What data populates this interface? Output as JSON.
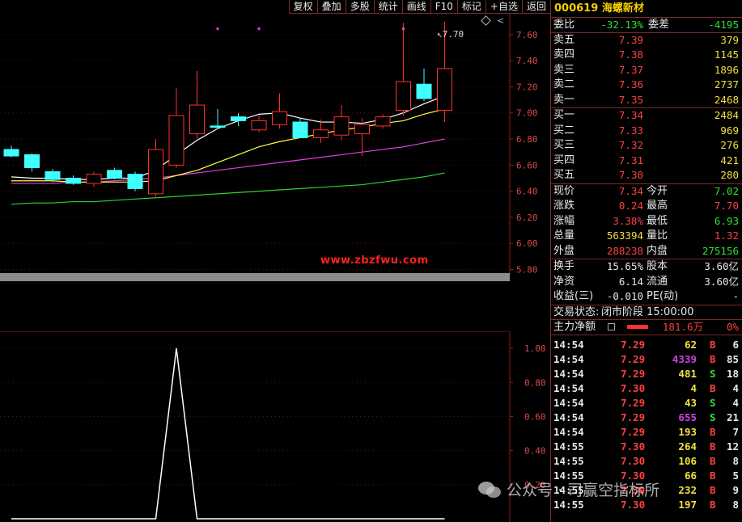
{
  "toolbar": [
    "复权",
    "叠加",
    "多股",
    "统计",
    "画线",
    "F10",
    "标记",
    "+自选",
    "返回"
  ],
  "chart": {
    "price_axis": [
      "7.60",
      "7.40",
      "7.20",
      "7.00",
      "6.80",
      "6.60",
      "6.40",
      "6.20",
      "6.00",
      "5.80"
    ],
    "sub_axis": [
      "1.00",
      "0.80",
      "0.60",
      "0.40",
      "0.20"
    ],
    "high_marker": "7.70",
    "watermark_url": "www.zbzfwu.com",
    "colors": {
      "up": "#ff3030",
      "down": "#40ffff",
      "ma5": "#ffffff",
      "ma10": "#ffff40",
      "ma20": "#e040e0",
      "ma60": "#30d030"
    }
  },
  "chart_data": {
    "type": "candlestick",
    "candles": [
      {
        "o": 6.72,
        "h": 6.75,
        "l": 6.66,
        "c": 6.67
      },
      {
        "o": 6.68,
        "h": 6.69,
        "l": 6.55,
        "c": 6.58
      },
      {
        "o": 6.55,
        "h": 6.57,
        "l": 6.47,
        "c": 6.49
      },
      {
        "o": 6.5,
        "h": 6.52,
        "l": 6.45,
        "c": 6.46
      },
      {
        "o": 6.46,
        "h": 6.55,
        "l": 6.43,
        "c": 6.53
      },
      {
        "o": 6.56,
        "h": 6.58,
        "l": 6.49,
        "c": 6.5
      },
      {
        "o": 6.53,
        "h": 6.55,
        "l": 6.4,
        "c": 6.42
      },
      {
        "o": 6.38,
        "h": 6.8,
        "l": 6.36,
        "c": 6.72
      },
      {
        "o": 6.6,
        "h": 7.19,
        "l": 6.58,
        "c": 6.98
      },
      {
        "o": 6.84,
        "h": 7.32,
        "l": 6.8,
        "c": 7.06
      },
      {
        "o": 6.9,
        "h": 7.03,
        "l": 6.88,
        "c": 6.89
      },
      {
        "o": 6.97,
        "h": 7.0,
        "l": 6.9,
        "c": 6.94
      },
      {
        "o": 6.87,
        "h": 6.98,
        "l": 6.85,
        "c": 6.94
      },
      {
        "o": 6.91,
        "h": 7.15,
        "l": 6.88,
        "c": 7.01
      },
      {
        "o": 6.93,
        "h": 6.96,
        "l": 6.82,
        "c": 6.81
      },
      {
        "o": 6.81,
        "h": 6.95,
        "l": 6.77,
        "c": 6.87
      },
      {
        "o": 6.83,
        "h": 7.06,
        "l": 6.79,
        "c": 6.97
      },
      {
        "o": 6.84,
        "h": 6.96,
        "l": 6.67,
        "c": 6.91
      },
      {
        "o": 6.9,
        "h": 6.99,
        "l": 6.88,
        "c": 6.97
      },
      {
        "o": 7.02,
        "h": 7.69,
        "l": 6.98,
        "c": 7.24
      },
      {
        "o": 7.22,
        "h": 7.34,
        "l": 7.09,
        "c": 7.11
      },
      {
        "o": 7.02,
        "h": 7.7,
        "l": 6.93,
        "c": 7.34
      }
    ],
    "ma5": [
      6.51,
      6.5,
      6.5,
      6.49,
      6.49,
      6.5,
      6.5,
      6.56,
      6.68,
      6.79,
      6.88,
      6.94,
      6.99,
      7.0,
      6.96,
      6.93,
      6.93,
      6.92,
      6.95,
      7.0,
      7.07,
      7.13
    ],
    "ma10": [
      6.48,
      6.48,
      6.48,
      6.47,
      6.47,
      6.47,
      6.47,
      6.48,
      6.52,
      6.56,
      6.62,
      6.68,
      6.74,
      6.78,
      6.81,
      6.84,
      6.87,
      6.89,
      6.92,
      6.94,
      6.99,
      7.03
    ],
    "ma20": [
      6.46,
      6.46,
      6.46,
      6.47,
      6.47,
      6.48,
      6.49,
      6.5,
      6.52,
      6.54,
      6.56,
      6.58,
      6.6,
      6.62,
      6.64,
      6.66,
      6.68,
      6.7,
      6.72,
      6.74,
      6.77,
      6.8
    ],
    "ma60": [
      6.3,
      6.31,
      6.31,
      6.32,
      6.32,
      6.33,
      6.34,
      6.35,
      6.36,
      6.37,
      6.38,
      6.39,
      6.4,
      6.41,
      6.42,
      6.43,
      6.44,
      6.45,
      6.47,
      6.49,
      6.51,
      6.54
    ],
    "indicator": [
      0,
      0,
      0,
      0,
      0,
      0,
      0,
      0,
      1,
      0,
      0,
      0,
      0,
      0,
      0,
      0,
      0,
      0,
      0,
      0,
      0,
      0
    ],
    "markers": [
      10,
      12,
      19
    ],
    "ylim": [
      5.76,
      7.76
    ],
    "sub_ylim": [
      0,
      1.1
    ]
  },
  "panel": {
    "code": "000619",
    "name": "海螺新材",
    "weibi": {
      "label": "委比",
      "value": "-32.13%",
      "label2": "委差",
      "value2": "-4195"
    },
    "asks": [
      {
        "label": "卖五",
        "price": "7.39",
        "vol": "379"
      },
      {
        "label": "卖四",
        "price": "7.38",
        "vol": "1145"
      },
      {
        "label": "卖三",
        "price": "7.37",
        "vol": "1896"
      },
      {
        "label": "卖二",
        "price": "7.36",
        "vol": "2737"
      },
      {
        "label": "卖一",
        "price": "7.35",
        "vol": "2468"
      }
    ],
    "bids": [
      {
        "label": "买一",
        "price": "7.34",
        "vol": "2484"
      },
      {
        "label": "买二",
        "price": "7.33",
        "vol": "969"
      },
      {
        "label": "买三",
        "price": "7.32",
        "vol": "276"
      },
      {
        "label": "买四",
        "price": "7.31",
        "vol": "421"
      },
      {
        "label": "买五",
        "price": "7.30",
        "vol": "280"
      }
    ],
    "stats": [
      {
        "l1": "现价",
        "v1": "7.34",
        "c1": "red",
        "l2": "今开",
        "v2": "7.02",
        "c2": "green"
      },
      {
        "l1": "涨跌",
        "v1": "0.24",
        "c1": "red",
        "l2": "最高",
        "v2": "7.70",
        "c2": "red"
      },
      {
        "l1": "涨幅",
        "v1": "3.38%",
        "c1": "red",
        "l2": "最低",
        "v2": "6.93",
        "c2": "green"
      },
      {
        "l1": "总量",
        "v1": "563394",
        "c1": "yellow",
        "l2": "量比",
        "v2": "1.32",
        "c2": "red"
      },
      {
        "l1": "外盘",
        "v1": "288238",
        "c1": "red",
        "l2": "内盘",
        "v2": "275156",
        "c2": "green"
      }
    ],
    "stats2": [
      {
        "l1": "换手",
        "v1": "15.65%",
        "l2": "股本",
        "v2": "3.60亿"
      },
      {
        "l1": "净资",
        "v1": "6.14",
        "l2": "流通",
        "v2": "3.60亿"
      },
      {
        "l1": "收益(三)",
        "v1": "-0.010",
        "l2": "PE(动)",
        "v2": "-"
      }
    ],
    "status": {
      "label": "交易状态:",
      "value": "闭市阶段 15:00:00"
    },
    "mainforce": {
      "label": "主力净额",
      "value": "181.6万",
      "pct": "0%"
    },
    "trades": [
      {
        "t": "14:54",
        "p": "7.29",
        "v": "62",
        "vc": "yellow",
        "s": "B",
        "sc": "red",
        "n": "6"
      },
      {
        "t": "14:54",
        "p": "7.29",
        "v": "4339",
        "vc": "magenta",
        "s": "B",
        "sc": "red",
        "n": "85"
      },
      {
        "t": "14:54",
        "p": "7.29",
        "v": "481",
        "vc": "yellow",
        "s": "S",
        "sc": "green",
        "n": "18"
      },
      {
        "t": "14:54",
        "p": "7.30",
        "v": "4",
        "vc": "yellow",
        "s": "B",
        "sc": "red",
        "n": "4"
      },
      {
        "t": "14:54",
        "p": "7.29",
        "v": "43",
        "vc": "yellow",
        "s": "S",
        "sc": "green",
        "n": "4"
      },
      {
        "t": "14:54",
        "p": "7.29",
        "v": "655",
        "vc": "magenta",
        "s": "S",
        "sc": "green",
        "n": "21"
      },
      {
        "t": "14:54",
        "p": "7.29",
        "v": "193",
        "vc": "yellow",
        "s": "B",
        "sc": "red",
        "n": "7"
      },
      {
        "t": "14:55",
        "p": "7.30",
        "v": "264",
        "vc": "yellow",
        "s": "B",
        "sc": "red",
        "n": "12"
      },
      {
        "t": "14:55",
        "p": "7.30",
        "v": "106",
        "vc": "yellow",
        "s": "B",
        "sc": "red",
        "n": "8"
      },
      {
        "t": "14:55",
        "p": "7.30",
        "v": "66",
        "vc": "yellow",
        "s": "B",
        "sc": "red",
        "n": "5"
      },
      {
        "t": "14:55",
        "p": "7.30",
        "v": "232",
        "vc": "yellow",
        "s": "B",
        "sc": "red",
        "n": "9"
      },
      {
        "t": "14:55",
        "p": "7.30",
        "v": "197",
        "vc": "yellow",
        "s": "B",
        "sc": "red",
        "n": "8"
      }
    ]
  },
  "overlay": {
    "text": "公众号 · 司赢空指标所"
  }
}
